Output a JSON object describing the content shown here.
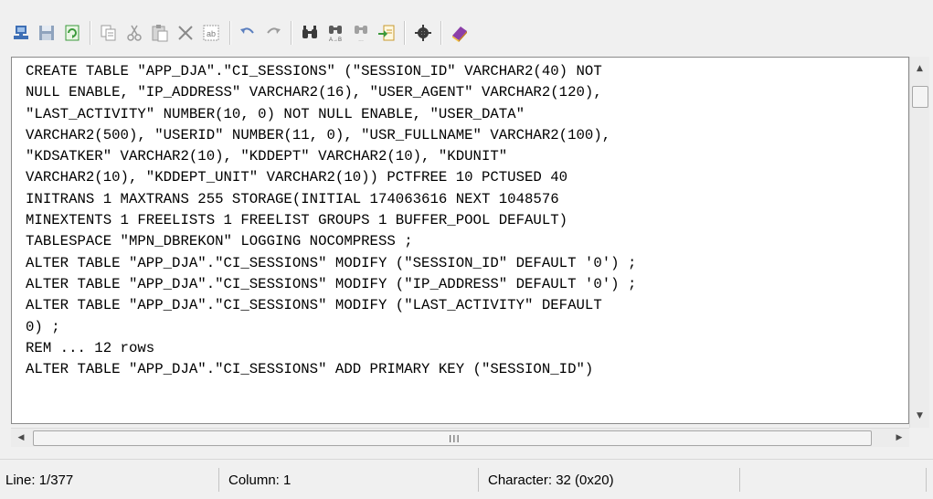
{
  "toolbar": {
    "buttons": [
      {
        "name": "new-connection-icon",
        "color": "#3e6fb5"
      },
      {
        "name": "save-icon",
        "color": "#8fa3bd"
      },
      {
        "name": "refresh-icon",
        "color": "#3b9a3b"
      },
      {
        "name": "copy-icon",
        "color": "#9b9b9b"
      },
      {
        "name": "cut-icon",
        "color": "#9b9b9b"
      },
      {
        "name": "paste-icon",
        "color": "#9b9b9b"
      },
      {
        "name": "delete-icon",
        "color": "#8a8a8a"
      },
      {
        "name": "select-all-icon",
        "color": "#9b9b9b"
      },
      {
        "name": "undo-icon",
        "color": "#5b7fbf"
      },
      {
        "name": "redo-icon",
        "color": "#9b9b9b"
      },
      {
        "name": "find-icon",
        "color": "#3a3a3a"
      },
      {
        "name": "find-replace-icon",
        "color": "#5a5a5a"
      },
      {
        "name": "find-next-icon",
        "color": "#a0a0a0"
      },
      {
        "name": "export-icon",
        "color": "#c99a2e"
      },
      {
        "name": "settings-icon",
        "color": "#3a3a3a"
      },
      {
        "name": "help-book-icon",
        "color": "#8b3fa8"
      }
    ]
  },
  "editor": {
    "lines": [
      "CREATE TABLE \"APP_DJA\".\"CI_SESSIONS\" (\"SESSION_ID\" VARCHAR2(40) NOT",
      "NULL ENABLE, \"IP_ADDRESS\" VARCHAR2(16), \"USER_AGENT\" VARCHAR2(120),",
      "\"LAST_ACTIVITY\" NUMBER(10, 0) NOT NULL ENABLE, \"USER_DATA\"",
      "VARCHAR2(500), \"USERID\" NUMBER(11, 0), \"USR_FULLNAME\" VARCHAR2(100),",
      "\"KDSATKER\" VARCHAR2(10), \"KDDEPT\" VARCHAR2(10), \"KDUNIT\"",
      "VARCHAR2(10), \"KDDEPT_UNIT\" VARCHAR2(10)) PCTFREE 10 PCTUSED 40",
      "INITRANS 1 MAXTRANS 255 STORAGE(INITIAL 174063616 NEXT 1048576",
      "MINEXTENTS 1 FREELISTS 1 FREELIST GROUPS 1 BUFFER_POOL DEFAULT)",
      "TABLESPACE \"MPN_DBREKON\" LOGGING NOCOMPRESS ;",
      "ALTER TABLE \"APP_DJA\".\"CI_SESSIONS\" MODIFY (\"SESSION_ID\" DEFAULT '0') ;",
      "ALTER TABLE \"APP_DJA\".\"CI_SESSIONS\" MODIFY (\"IP_ADDRESS\" DEFAULT '0') ;",
      "ALTER TABLE \"APP_DJA\".\"CI_SESSIONS\" MODIFY (\"LAST_ACTIVITY\" DEFAULT",
      "0) ;",
      "REM ... 12 rows",
      "ALTER TABLE \"APP_DJA\".\"CI_SESSIONS\" ADD PRIMARY KEY (\"SESSION_ID\")"
    ]
  },
  "scrollbars": {
    "vertical_up": "▲",
    "vertical_down": "▼",
    "horizontal_left": "◀",
    "horizontal_right": "▶",
    "horizontal_grip": "III"
  },
  "statusbar": {
    "line": "Line: 1/377",
    "column": "Column: 1",
    "character": "Character: 32 (0x20)",
    "extra": ""
  }
}
